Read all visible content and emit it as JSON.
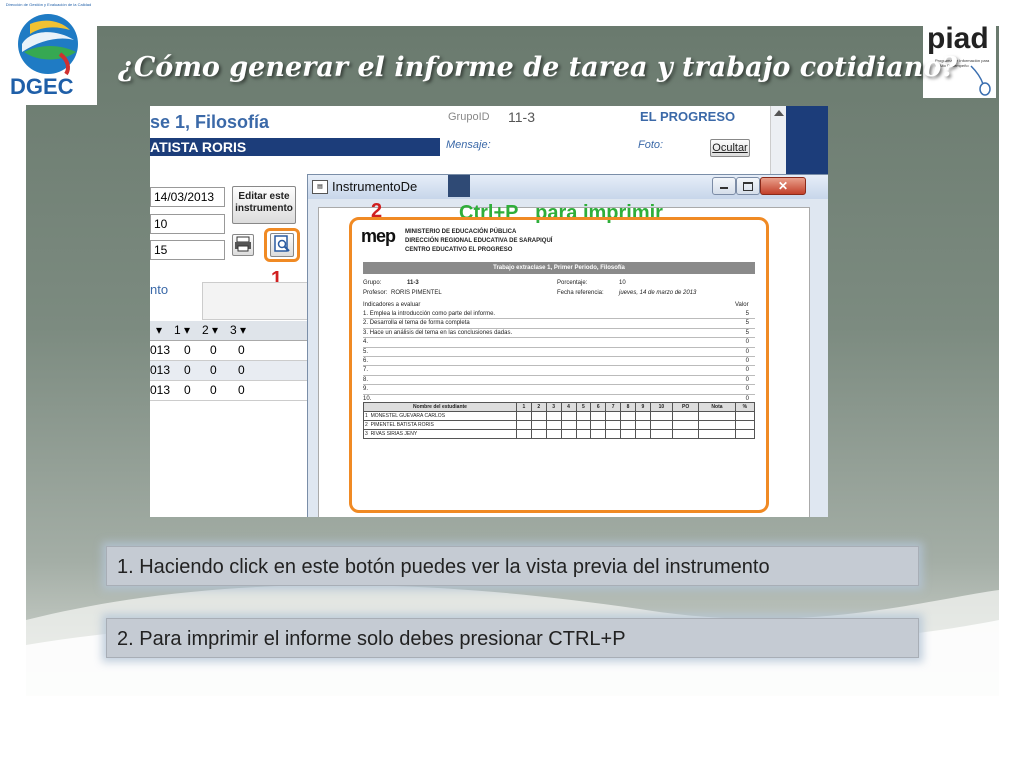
{
  "slide": {
    "title": "¿Cómo  generar el informe de tarea y trabajo cotidiano?",
    "logo_left_text": "DGEC",
    "logo_left_ring": "Dirección de Gestión y Evaluación de la Calidad",
    "logo_right_text": "piad",
    "logo_right_sub": "Programa de Información para el Alto Desempeño"
  },
  "app": {
    "course_title": "se 1, Filosofía",
    "student_banner": "ATISTA RORIS",
    "groupid_label": "GrupoID",
    "groupid_value": "11-3",
    "school": "EL PROGRESO",
    "mensaje_label": "Mensaje:",
    "foto_label": "Foto:",
    "ocultar_button": "Ocultar",
    "date_value": "14/03/2013",
    "field2_value": "10",
    "field3_value": "15",
    "edit_button": "Editar este instrumento",
    "side_label": "nto",
    "grid_headers": [
      "1",
      "2",
      "3"
    ],
    "grid_rows": [
      [
        "013",
        "0",
        "0",
        "0"
      ],
      [
        "013",
        "0",
        "0",
        "0"
      ],
      [
        "013",
        "0",
        "0",
        "0"
      ]
    ],
    "marker_1": "1"
  },
  "dialog": {
    "title": "InstrumentoDe",
    "marker_2": "2",
    "ctrl_hint_key": "Ctrl+P",
    "ctrl_hint_text": "para imprimir",
    "doc": {
      "logo": "mep",
      "header_lines": [
        "MINISTERIO DE EDUCACIÓN PÚBLICA",
        "DIRECCIÓN REGIONAL EDUCATIVA DE SARAPIQUÍ",
        "CENTRO EDUCATIVO EL PROGRESO"
      ],
      "banner": "Trabajo extraclase 1, Primer Periodo, Filosofía",
      "grupo_label": "Grupo:",
      "grupo_value": "11-3",
      "porcentaje_label": "Porcentaje:",
      "porcentaje_value": "10",
      "profesor_label": "Profesor:",
      "profesor_value": "RORIS PIMENTEL",
      "fecha_label": "Fecha referencia:",
      "fecha_value": "jueves, 14 de marzo de 2013",
      "indicadores_label": "Indicadores a evaluar",
      "valor_label": "Valor",
      "indicators": [
        {
          "n": "1.",
          "text": "Emplea la introducción como parte del informe.",
          "v": "5"
        },
        {
          "n": "2.",
          "text": "Desarrolla el tema de forma completa",
          "v": "5"
        },
        {
          "n": "3.",
          "text": "Hace un análisis del tema en las conclusiones dadas.",
          "v": "5"
        },
        {
          "n": "4.",
          "text": "",
          "v": "0"
        },
        {
          "n": "5.",
          "text": "",
          "v": "0"
        },
        {
          "n": "6.",
          "text": "",
          "v": "0"
        },
        {
          "n": "7.",
          "text": "",
          "v": "0"
        },
        {
          "n": "8.",
          "text": "",
          "v": "0"
        },
        {
          "n": "9.",
          "text": "",
          "v": "0"
        },
        {
          "n": "10.",
          "text": "",
          "v": "0"
        }
      ],
      "table_headers": [
        "Nombre del estudiante",
        "1",
        "2",
        "3",
        "4",
        "5",
        "6",
        "7",
        "8",
        "9",
        "10",
        "PO",
        "Nota",
        "%"
      ],
      "students": [
        {
          "n": "1",
          "name": "MONESTEL GUEVARA CARLOS"
        },
        {
          "n": "2",
          "name": "PIMENTEL BATISTA RORIS"
        },
        {
          "n": "3",
          "name": "RIVAS SIRIAS JENY"
        }
      ]
    }
  },
  "captions": [
    "1. Haciendo click en este botón puedes ver la vista previa del instrumento",
    "2. Para imprimir el informe solo debes presionar CTRL+P"
  ],
  "colors": {
    "orange": "#f08a24",
    "red_marker": "#d02020",
    "green_hint": "#2fae3a",
    "blue_title": "#3b69a8"
  }
}
